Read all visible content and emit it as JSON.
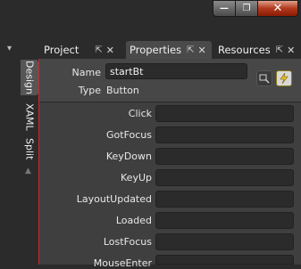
{
  "window": {
    "minimize_glyph": "—",
    "maximize_glyph": "❐",
    "close_glyph": "✕"
  },
  "tabs": [
    {
      "label": "Project",
      "active": false
    },
    {
      "label": "Properties",
      "active": true
    },
    {
      "label": "Resources",
      "active": false
    }
  ],
  "tab_icons": {
    "pin": "⇱",
    "close": "✕",
    "dropdown": "▾"
  },
  "side_tabs": [
    {
      "label": "Design",
      "active": true
    },
    {
      "label": "XAML",
      "active": false
    },
    {
      "label": "Split",
      "active": false
    }
  ],
  "scroll_up_glyph": "▲",
  "properties": {
    "name_label": "Name",
    "name_value": "startBt",
    "type_label": "Type",
    "type_value": "Button"
  },
  "events": [
    "Click",
    "GotFocus",
    "KeyDown",
    "KeyUp",
    "LayoutUpdated",
    "Loaded",
    "LostFocus",
    "MouseEnter"
  ],
  "colors": {
    "accent_line": "#c22a2a",
    "events_button": "#e8c21c"
  }
}
